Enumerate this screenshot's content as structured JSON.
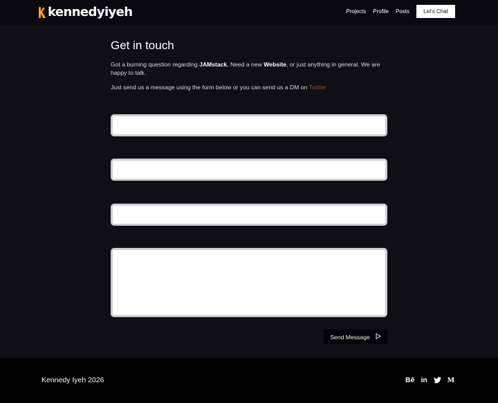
{
  "header": {
    "logo_text": "kennedyiyeh",
    "nav": [
      {
        "label": "Projects"
      },
      {
        "label": "Profile"
      },
      {
        "label": "Posts"
      }
    ],
    "cta_label": "Let's Chat"
  },
  "main": {
    "title": "Get in touch",
    "intro_part1": "Got a burning question regarding ",
    "intro_bold1": "JAMstack",
    "intro_part2": ", Need a new ",
    "intro_bold2": "Website",
    "intro_part3": ", or just anything in general. We are happy to talk.",
    "intro2_text": "Just send us a message using the form below or you can send us a DM on ",
    "twitter_link": "Twitter",
    "form": {
      "field1_value": "",
      "field2_value": "",
      "field3_value": "",
      "message_value": "",
      "send_label": "Send Message",
      "send_icon": "send-icon"
    }
  },
  "footer": {
    "copyright": "Kennedy Iyeh 2026",
    "socials": [
      {
        "label": "Bē",
        "icon": "behance-icon"
      },
      {
        "label": "in",
        "icon": "linkedin-icon"
      },
      {
        "icon": "twitter-icon"
      },
      {
        "label": "M",
        "icon": "medium-icon"
      }
    ]
  },
  "colors": {
    "background": "#0f0f14",
    "header_bg": "#0a0a0e",
    "footer_bg": "#000000",
    "accent_logo": "#f5a623",
    "link": "#a0522d"
  }
}
